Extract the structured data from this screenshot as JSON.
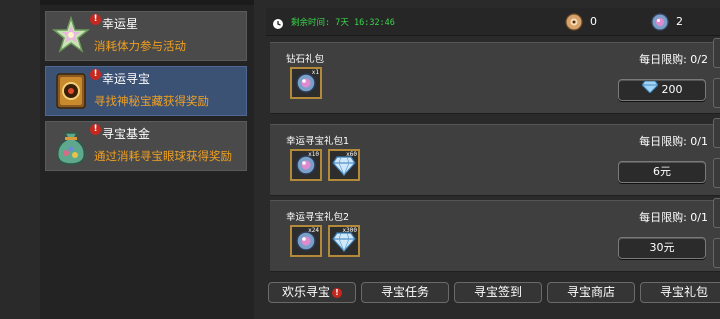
{
  "sidebar": {
    "items": [
      {
        "title": "幸运星",
        "desc": "消耗体力参与活动",
        "badge": "!"
      },
      {
        "title": "幸运寻宝",
        "desc": "寻找神秘宝藏获得奖励",
        "badge": "!"
      },
      {
        "title": "寻宝基金",
        "desc": "通过消耗寻宝眼球获得奖励",
        "badge": "!"
      }
    ]
  },
  "header": {
    "timer": "剩余时间: 7天 16:32:46",
    "currency_a": "0",
    "currency_b": "2"
  },
  "packs": [
    {
      "title": "钻石礼包",
      "limit": "每日限购: 0/2",
      "price": "200",
      "items": [
        {
          "icon": "orb-icon",
          "qty": "x1"
        }
      ]
    },
    {
      "title": "幸运寻宝礼包1",
      "limit": "每日限购: 0/1",
      "price": "6元",
      "items": [
        {
          "icon": "orb-icon",
          "qty": "x10"
        },
        {
          "icon": "diamond-icon",
          "qty": "x60"
        }
      ]
    },
    {
      "title": "幸运寻宝礼包2",
      "limit": "每日限购: 0/1",
      "price": "30元",
      "items": [
        {
          "icon": "orb-icon",
          "qty": "x24"
        },
        {
          "icon": "diamond-icon",
          "qty": "x300"
        }
      ]
    }
  ],
  "tabs": [
    {
      "label": "欢乐寻宝",
      "badge": "!"
    },
    {
      "label": "寻宝任务"
    },
    {
      "label": "寻宝签到"
    },
    {
      "label": "寻宝商店"
    },
    {
      "label": "寻宝礼包"
    }
  ],
  "colors": {
    "accent_orange": "#f0a021",
    "timer_green": "#38d64a",
    "active_blue": "#3c5275",
    "badge_red": "#c6281f",
    "slot_gold": "#b38a3a"
  }
}
